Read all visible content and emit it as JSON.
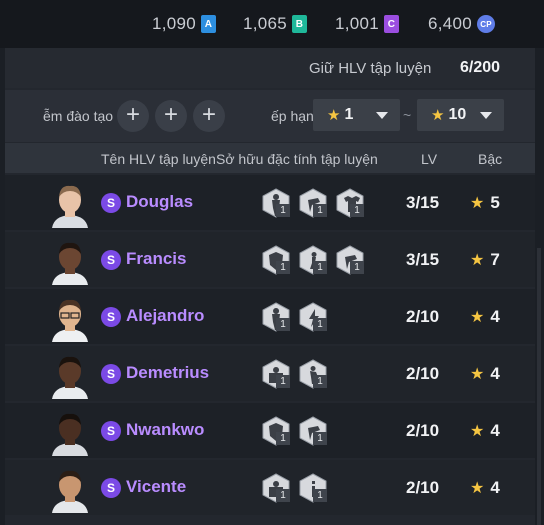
{
  "currencies": [
    {
      "value": "1,090",
      "badge": "A",
      "color": "#2d8fe0"
    },
    {
      "value": "1,065",
      "badge": "B",
      "color": "#1fb89a"
    },
    {
      "value": "1,001",
      "badge": "C",
      "color": "#9b4ee0"
    },
    {
      "value": "6,400",
      "badge": "CP",
      "color": "#5f7de8"
    }
  ],
  "hold": {
    "label": "Giữ HLV tập luyện",
    "value": "6/200"
  },
  "filters": {
    "training_label": "ễm đào tạo",
    "plus": "+",
    "rank_label": "ếp hạng",
    "min_value": "1",
    "max_value": "10",
    "separator": "~"
  },
  "table": {
    "headers": {
      "name": "Tên HLV tập luyện",
      "traits": "Sở hữu đặc tính tập luyện",
      "lv": "LV",
      "rank": "Bậc"
    },
    "rows": [
      {
        "name": "Douglas",
        "lv": "3/15",
        "rank": "5",
        "skills": [
          {
            "icon": "player-icon",
            "count": "1"
          },
          {
            "icon": "kick-icon",
            "count": "1"
          },
          {
            "icon": "jersey-icon",
            "count": "1"
          }
        ]
      },
      {
        "name": "Francis",
        "lv": "3/15",
        "rank": "7",
        "skills": [
          {
            "icon": "shield-icon",
            "count": "1"
          },
          {
            "icon": "sprint-icon",
            "count": "1"
          },
          {
            "icon": "kick-icon",
            "count": "1"
          }
        ]
      },
      {
        "name": "Alejandro",
        "lv": "2/10",
        "rank": "4",
        "skills": [
          {
            "icon": "player-icon",
            "count": "1"
          },
          {
            "icon": "lightning-icon",
            "count": "1"
          }
        ]
      },
      {
        "name": "Demetrius",
        "lv": "2/10",
        "rank": "4",
        "skills": [
          {
            "icon": "goalkeeper-icon",
            "count": "1"
          },
          {
            "icon": "run-icon",
            "count": "1"
          }
        ]
      },
      {
        "name": "Nwankwo",
        "lv": "2/10",
        "rank": "4",
        "skills": [
          {
            "icon": "shield-icon",
            "count": "1"
          },
          {
            "icon": "kick-icon",
            "count": "1"
          }
        ]
      },
      {
        "name": "Vicente",
        "lv": "2/10",
        "rank": "4",
        "skills": [
          {
            "icon": "goalkeeper-icon",
            "count": "1"
          },
          {
            "icon": "info-icon",
            "count": "1"
          }
        ]
      }
    ]
  },
  "badge_letter": "S",
  "star": "★"
}
